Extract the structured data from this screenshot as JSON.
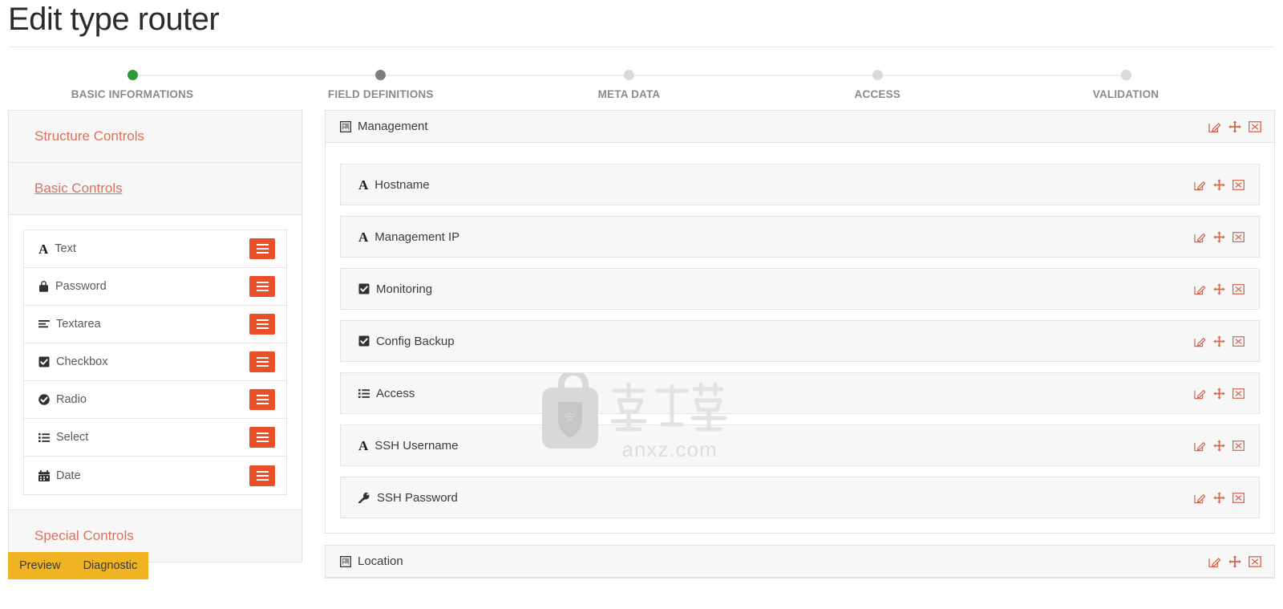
{
  "page": {
    "title": "Edit type router"
  },
  "stepper": {
    "steps": [
      {
        "label": "BASIC INFORMATIONS",
        "state": "done"
      },
      {
        "label": "FIELD DEFINITIONS",
        "state": "active"
      },
      {
        "label": "META DATA",
        "state": "inactive"
      },
      {
        "label": "ACCESS",
        "state": "inactive"
      },
      {
        "label": "VALIDATION",
        "state": "inactive"
      }
    ]
  },
  "sidebar": {
    "sections": [
      {
        "label": "Structure Controls",
        "open": false
      },
      {
        "label": "Basic Controls",
        "open": true
      },
      {
        "label": "Special Controls",
        "open": false
      }
    ],
    "basic_controls": [
      {
        "label": "Text",
        "icon": "letter-a-icon"
      },
      {
        "label": "Password",
        "icon": "lock-icon"
      },
      {
        "label": "Textarea",
        "icon": "align-left-icon"
      },
      {
        "label": "Checkbox",
        "icon": "checkbox-checked-icon"
      },
      {
        "label": "Radio",
        "icon": "radio-check-circle-icon"
      },
      {
        "label": "Select",
        "icon": "list-ul-icon"
      },
      {
        "label": "Date",
        "icon": "calendar-icon"
      }
    ],
    "actions": [
      {
        "label": "Preview"
      },
      {
        "label": "Diagnostic"
      }
    ]
  },
  "main": {
    "groups": [
      {
        "title": "Management",
        "icon": "group-panel-icon",
        "fields": [
          {
            "label": "Hostname",
            "icon": "letter-a-icon"
          },
          {
            "label": "Management IP",
            "icon": "letter-a-icon"
          },
          {
            "label": "Monitoring",
            "icon": "checkbox-checked-icon"
          },
          {
            "label": "Config Backup",
            "icon": "checkbox-checked-icon"
          },
          {
            "label": "Access",
            "icon": "list-ul-icon"
          },
          {
            "label": "SSH Username",
            "icon": "letter-a-icon"
          },
          {
            "label": "SSH Password",
            "icon": "key-icon"
          }
        ]
      },
      {
        "title": "Location",
        "icon": "group-panel-icon",
        "fields": []
      }
    ],
    "row_actions": [
      {
        "name": "edit-icon",
        "title": "Edit"
      },
      {
        "name": "move-icon",
        "title": "Move"
      },
      {
        "name": "delete-icon",
        "title": "Delete"
      }
    ]
  },
  "watermark": {
    "text_cn": "安下载",
    "text_url": "anxz.com"
  },
  "colors": {
    "accent_orange": "#e8502a",
    "link_salmon": "#d9715f",
    "action_icon": "#d2664f",
    "step_done": "#2e9b36",
    "step_active": "#7d7d7d",
    "step_inactive": "#d9d9d9",
    "yellow_bar": "#f0b422"
  }
}
